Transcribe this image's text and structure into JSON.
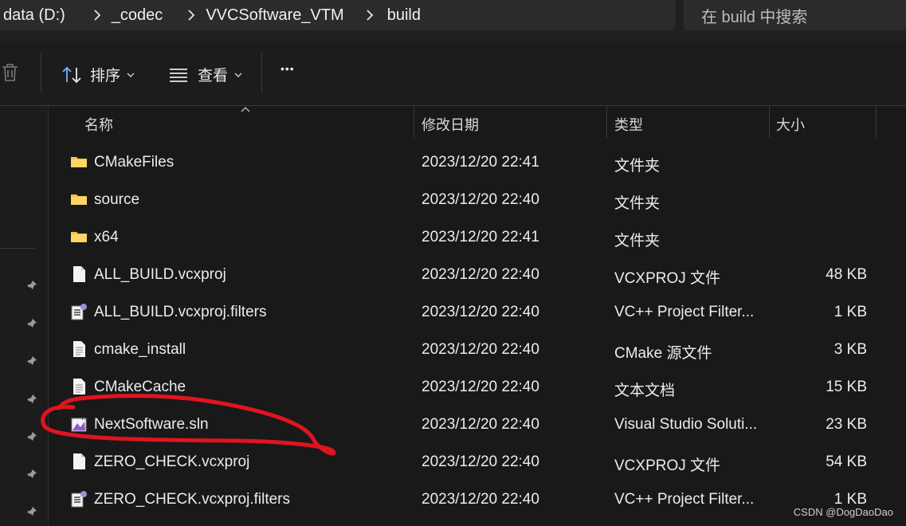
{
  "address": {
    "crumbs": [
      "data (D:)",
      "_codec",
      "VVCSoftware_VTM",
      "build"
    ]
  },
  "search": {
    "placeholder": "在 build 中搜索"
  },
  "toolbar": {
    "sort_label": "排序",
    "view_label": "查看",
    "more_label": "•••"
  },
  "columns": {
    "name": "名称",
    "date": "修改日期",
    "type": "类型",
    "size": "大小"
  },
  "files": [
    {
      "name": "CMakeFiles",
      "date": "2023/12/20 22:41",
      "type": "文件夹",
      "size": "",
      "icon": "folder-icon"
    },
    {
      "name": "source",
      "date": "2023/12/20 22:40",
      "type": "文件夹",
      "size": "",
      "icon": "folder-icon"
    },
    {
      "name": "x64",
      "date": "2023/12/20 22:41",
      "type": "文件夹",
      "size": "",
      "icon": "folder-icon"
    },
    {
      "name": "ALL_BUILD.vcxproj",
      "date": "2023/12/20 22:40",
      "type": "VCXPROJ 文件",
      "size": "48 KB",
      "icon": "file-icon"
    },
    {
      "name": "ALL_BUILD.vcxproj.filters",
      "date": "2023/12/20 22:40",
      "type": "VC++ Project Filter...",
      "size": "1 KB",
      "icon": "filters-file-icon"
    },
    {
      "name": "cmake_install",
      "date": "2023/12/20 22:40",
      "type": "CMake 源文件",
      "size": "3 KB",
      "icon": "text-file-icon"
    },
    {
      "name": "CMakeCache",
      "date": "2023/12/20 22:40",
      "type": "文本文档",
      "size": "15 KB",
      "icon": "text-file-icon"
    },
    {
      "name": "NextSoftware.sln",
      "date": "2023/12/20 22:40",
      "type": "Visual Studio Soluti...",
      "size": "23 KB",
      "icon": "vs-solution-icon"
    },
    {
      "name": "ZERO_CHECK.vcxproj",
      "date": "2023/12/20 22:40",
      "type": "VCXPROJ 文件",
      "size": "54 KB",
      "icon": "file-icon"
    },
    {
      "name": "ZERO_CHECK.vcxproj.filters",
      "date": "2023/12/20 22:40",
      "type": "VC++ Project Filter...",
      "size": "1 KB",
      "icon": "filters-file-icon"
    }
  ],
  "colors": {
    "folder": "#f5c342",
    "annotation": "#e0141e",
    "vs_purple": "#8a5bd6"
  },
  "watermark": "CSDN @DogDaoDao"
}
